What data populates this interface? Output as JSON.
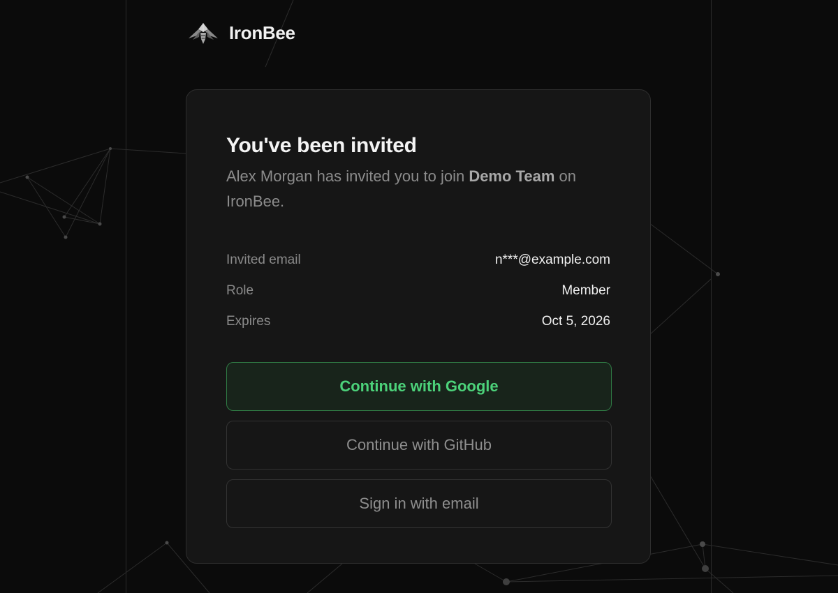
{
  "brand": {
    "name": "IronBee",
    "logo_icon": "bee-logo-icon"
  },
  "invite": {
    "title": "You've been invited",
    "subtitle_prefix": "Alex Morgan has invited you to join ",
    "team_name": "Demo Team",
    "subtitle_suffix": " on IronBee.",
    "details": [
      {
        "label": "Invited email",
        "value": "n***@example.com"
      },
      {
        "label": "Role",
        "value": "Member"
      },
      {
        "label": "Expires",
        "value": "Oct 5, 2026"
      }
    ]
  },
  "actions": {
    "google_label": "Continue with Google",
    "github_label": "Continue with GitHub",
    "email_label": "Sign in with email"
  },
  "colors": {
    "background": "#0b0b0b",
    "card": "#161616",
    "accent_green": "#4cd27a",
    "accent_border": "#2f7a44"
  }
}
